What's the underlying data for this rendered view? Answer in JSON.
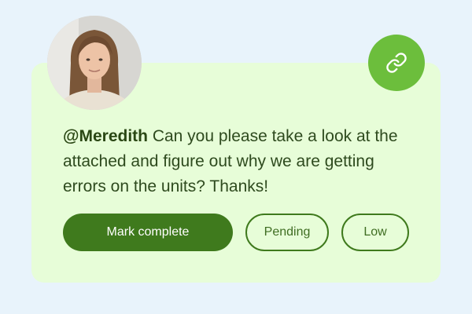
{
  "comment": {
    "mention": "@Meredith",
    "text": " Can you please take a look at the attached and figure out why we are getting errors on the units? Thanks!"
  },
  "actions": {
    "mark_complete": "Mark complete",
    "status": "Pending",
    "priority": "Low"
  },
  "icons": {
    "link": "link-icon",
    "avatar": "avatar"
  },
  "colors": {
    "page_background": "#e8f3fb",
    "card_background": "#e7fdd8",
    "accent": "#6cbe3c",
    "primary_button": "#3f7a1d",
    "text": "#2e4a1e"
  }
}
